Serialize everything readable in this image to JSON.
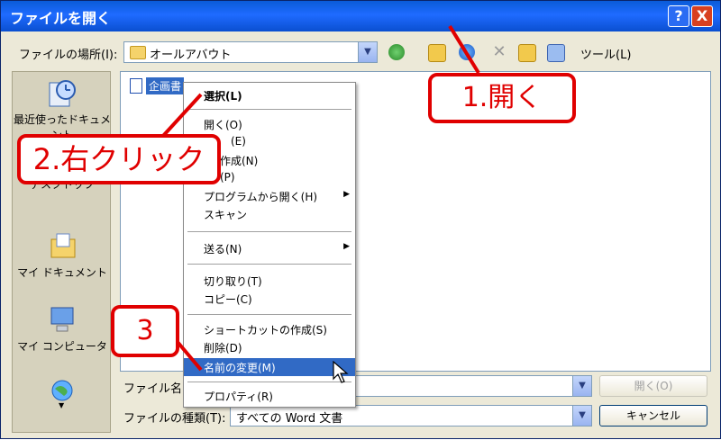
{
  "window": {
    "title": "ファイルを開く",
    "help": "?",
    "close": "X"
  },
  "lookin": {
    "label": "ファイルの場所(I):",
    "value": "オールアバウト"
  },
  "toolbar": {
    "tools_label": "ツール(L)"
  },
  "places": [
    {
      "label": "最近使ったドキュメント"
    },
    {
      "label": "デスクトップ"
    },
    {
      "label": "マイ ドキュメント"
    },
    {
      "label": "マイ コンピュータ"
    }
  ],
  "file": {
    "name": "企画書"
  },
  "context_menu": {
    "items": [
      {
        "label": "選択(L)"
      },
      {
        "label": "開く(O)"
      },
      {
        "label": "(E)"
      },
      {
        "label": "作成(N)"
      },
      {
        "label": "(P)"
      },
      {
        "label": "プログラムから開く(H)"
      },
      {
        "label": "スキャン"
      },
      {
        "label": "送る(N)"
      },
      {
        "label": "切り取り(T)"
      },
      {
        "label": "コピー(C)"
      },
      {
        "label": "ショートカットの作成(S)"
      },
      {
        "label": "削除(D)"
      },
      {
        "label": "名前の変更(M)"
      },
      {
        "label": "プロパティ(R)"
      }
    ]
  },
  "filename": {
    "label": "ファイル名(",
    "value": ""
  },
  "filetype": {
    "label": "ファイルの種類(T):",
    "value": "すべての Word 文書"
  },
  "buttons": {
    "open": "開く(O)",
    "cancel": "キャンセル"
  },
  "callouts": {
    "c1": "1.開く",
    "c2": "2.右クリック",
    "c3": "3"
  },
  "colors": {
    "accent": "#e00000",
    "highlight": "#316ac5",
    "titlebar": "#1f6bff"
  }
}
